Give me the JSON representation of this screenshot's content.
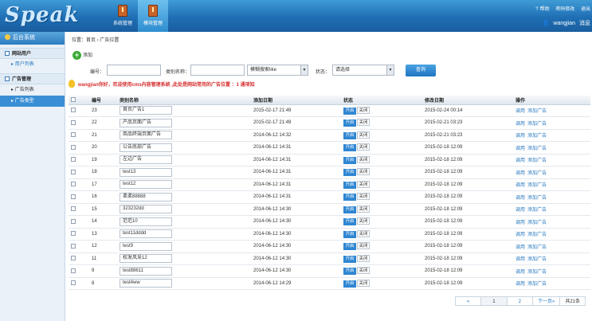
{
  "header": {
    "logo": "Speak",
    "nav": [
      {
        "label": "系统管理",
        "active": false
      },
      {
        "label": "模块管理",
        "active": true
      }
    ],
    "links": [
      "帮助",
      "密码修改",
      "退出"
    ],
    "user": "wangjian",
    "message": "消息"
  },
  "sidebar": {
    "title": "后台系统",
    "groups": [
      {
        "label": "网站用户",
        "items": [
          {
            "label": "用户列表",
            "active": false
          }
        ]
      },
      {
        "label": "广告管理",
        "items": [
          {
            "label": "广告列表",
            "active": false
          },
          {
            "label": "广告类型",
            "active": true
          }
        ]
      }
    ]
  },
  "main": {
    "breadcrumb": "位置：首页 › 广告位置",
    "add_label": "添加",
    "filter": {
      "id_label": "编号：",
      "name_label": "类别名称：",
      "mode_value": "模糊搜索like",
      "status_label": "状态：",
      "status_value": "请选择",
      "query_label": "查询"
    },
    "notice": "wangjian你好，欢迎使用cms内容管理系统 ,此处是网站常用的广告位置 ：1 通项知",
    "table": {
      "headers": [
        "",
        "编号",
        "类别名称",
        "添加日期",
        "状态",
        "修改日期",
        "操作"
      ],
      "on_label": "开启",
      "off_label": "关闭",
      "op_call": "调用",
      "op_add": "添加广告",
      "rows": [
        {
          "id": "23",
          "name": "首页广告1",
          "added": "2015-02-17 21:49",
          "modified": "2015-02-24 00:14"
        },
        {
          "id": "22",
          "name": "产品页面广告",
          "added": "2015-02-17 21:49",
          "modified": "2015-02-21 03:23"
        },
        {
          "id": "21",
          "name": "商品终端页面广告",
          "added": "2014-06-12 14:32",
          "modified": "2015-02-21 03:23"
        },
        {
          "id": "20",
          "name": "公告底部广告",
          "added": "2014-06-12 14:31",
          "modified": "2015-02-18 12:09"
        },
        {
          "id": "19",
          "name": "左边广告",
          "added": "2014-06-12 14:31",
          "modified": "2015-02-18 12:09"
        },
        {
          "id": "18",
          "name": "test13",
          "added": "2014-06-12 14:31",
          "modified": "2015-02-18 12:09"
        },
        {
          "id": "17",
          "name": "test12",
          "added": "2014-06-12 14:31",
          "modified": "2015-02-18 12:09"
        },
        {
          "id": "16",
          "name": "柔柔88888",
          "added": "2014-06-12 14:31",
          "modified": "2015-02-18 12:09"
        },
        {
          "id": "15",
          "name": "323232dd",
          "added": "2014-06-12 14:30",
          "modified": "2015-02-18 12:09"
        },
        {
          "id": "14",
          "name": "范范10",
          "added": "2014-06-12 14:30",
          "modified": "2015-02-18 12:09"
        },
        {
          "id": "13",
          "name": "test11dddd",
          "added": "2014-06-12 14:30",
          "modified": "2015-02-18 12:09"
        },
        {
          "id": "12",
          "name": "test9",
          "added": "2014-06-12 14:30",
          "modified": "2015-02-18 12:09"
        },
        {
          "id": "11",
          "name": "权发风采12",
          "added": "2014-06-12 14:30",
          "modified": "2015-02-18 12:09"
        },
        {
          "id": "9",
          "name": "test88611",
          "added": "2014-06-12 14:30",
          "modified": "2015-02-18 12:09"
        },
        {
          "id": "8",
          "name": "test4ww",
          "added": "2014-06-12 14:29",
          "modified": "2015-02-18 12:09"
        }
      ]
    },
    "pager": {
      "prev": "«",
      "pages": [
        "1",
        "2"
      ],
      "next": "下一页»",
      "total": "共21条"
    }
  }
}
